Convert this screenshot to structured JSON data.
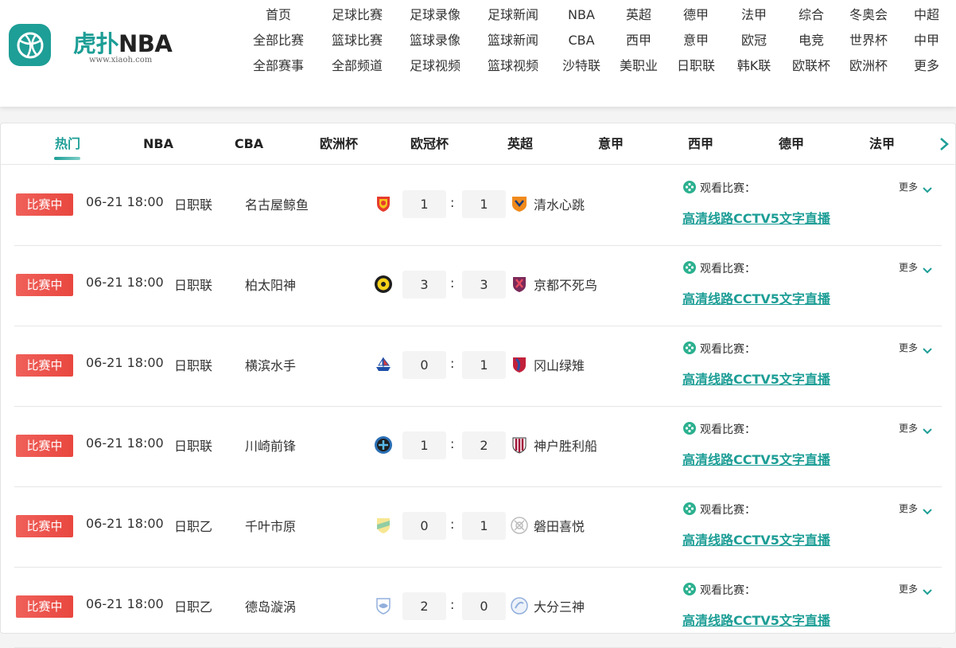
{
  "brand": {
    "name_cn": "虎扑",
    "name_en": "NBA",
    "domain": "www.xiaoh.com"
  },
  "nav": {
    "rows": [
      [
        "首页",
        "足球比赛",
        "足球录像",
        "足球新闻",
        "NBA",
        "英超",
        "德甲",
        "法甲",
        "综合",
        "冬奥会",
        "中超"
      ],
      [
        "全部比赛",
        "篮球比赛",
        "篮球录像",
        "篮球新闻",
        "CBA",
        "西甲",
        "意甲",
        "欧冠",
        "电竞",
        "世界杯",
        "中甲"
      ],
      [
        "全部赛事",
        "全部频道",
        "足球视频",
        "篮球视频",
        "沙特联",
        "美职业",
        "日职联",
        "韩K联",
        "欧联杯",
        "欧洲杯",
        "更多"
      ]
    ]
  },
  "tabs": [
    "热门",
    "NBA",
    "CBA",
    "欧洲杯",
    "欧冠杯",
    "英超",
    "意甲",
    "西甲",
    "德甲",
    "法甲"
  ],
  "active_tab": "热门",
  "colors": {
    "accent": "#1d9e96",
    "live": "#e8473f"
  },
  "match_labels": {
    "watch": "观看比赛：",
    "more": "更多"
  },
  "matches": [
    {
      "status": "比赛中",
      "time": "06-21 18:00",
      "league": "日职联",
      "home": "名古屋鲸鱼",
      "home_score": "1",
      "away_score": "1",
      "away": "清水心跳",
      "link": "高清线路CCTV5文字直播",
      "home_crest": "shield-red-yellow",
      "away_crest": "shield-orange"
    },
    {
      "status": "比赛中",
      "time": "06-21 18:00",
      "league": "日职联",
      "home": "柏太阳神",
      "home_score": "3",
      "away_score": "3",
      "away": "京都不死鸟",
      "link": "高清线路CCTV5文字直播",
      "home_crest": "round-yellow-black",
      "away_crest": "shield-purple-red"
    },
    {
      "status": "比赛中",
      "time": "06-21 18:00",
      "league": "日职联",
      "home": "横滨水手",
      "home_score": "0",
      "away_score": "1",
      "away": "冈山绿雉",
      "link": "高清线路CCTV5文字直播",
      "home_crest": "ship-blue",
      "away_crest": "shield-red-blue"
    },
    {
      "status": "比赛中",
      "time": "06-21 18:00",
      "league": "日职联",
      "home": "川崎前锋",
      "home_score": "1",
      "away_score": "2",
      "away": "神户胜利船",
      "link": "高清线路CCTV5文字直播",
      "home_crest": "round-blue",
      "away_crest": "shield-red-stripes"
    },
    {
      "status": "比赛中",
      "time": "06-21 18:00",
      "league": "日职乙",
      "home": "千叶市原",
      "home_score": "0",
      "away_score": "1",
      "away": "磐田喜悦",
      "link": "高清线路CCTV5文字直播",
      "home_crest": "shield-yellow-green",
      "away_crest": "round-grey"
    },
    {
      "status": "比赛中",
      "time": "06-21 18:00",
      "league": "日职乙",
      "home": "德岛漩涡",
      "home_score": "2",
      "away_score": "0",
      "away": "大分三神",
      "link": "高清线路CCTV5文字直播",
      "home_crest": "shield-blue-light",
      "away_crest": "round-blue-light"
    }
  ]
}
